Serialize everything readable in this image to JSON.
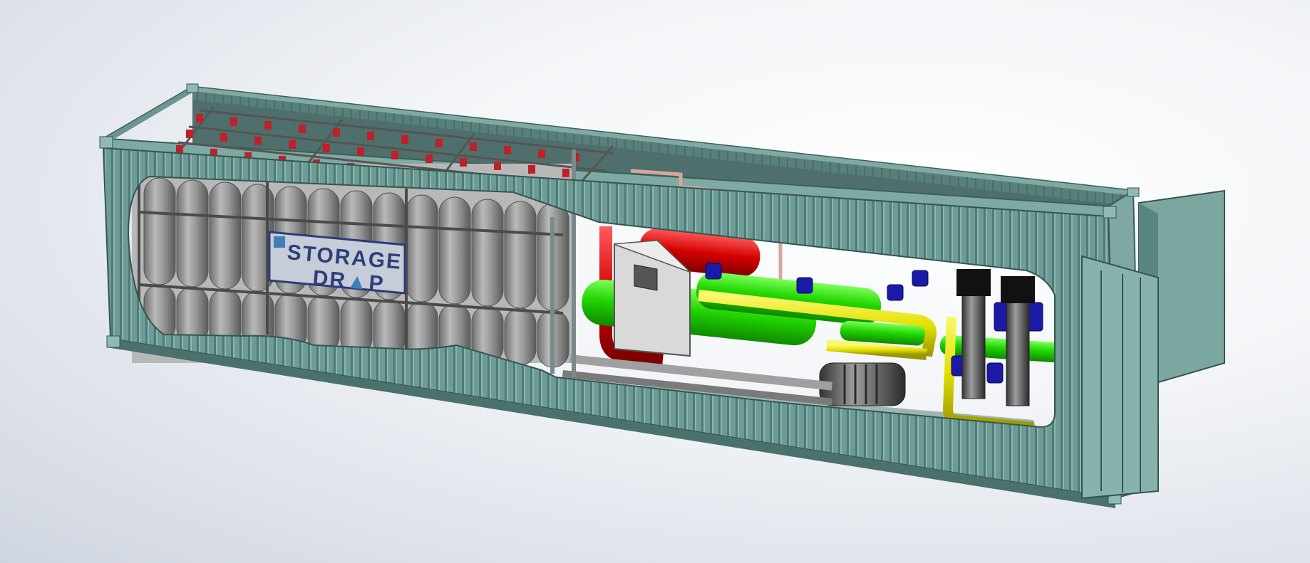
{
  "scene": {
    "background": [
      "#ffffff",
      "#dfe3ea"
    ]
  },
  "logo": {
    "line1": "STORAGE",
    "line2": "DR",
    "line2_suffix": "P",
    "border_color": "#2b3c7a",
    "text_color": "#2e3f78"
  },
  "colors": {
    "container": "#6d9b95",
    "container_dark": "#4d7470",
    "container_light": "#8fbbb4",
    "pipe_yellow": "#e4e000",
    "pipe_green": "#22d600",
    "pipe_red": "#d40000",
    "cylinder_gray": "#9a9a9a",
    "pump_blue": "#1a1aa6",
    "panel_gray": "#d9d9d9"
  }
}
